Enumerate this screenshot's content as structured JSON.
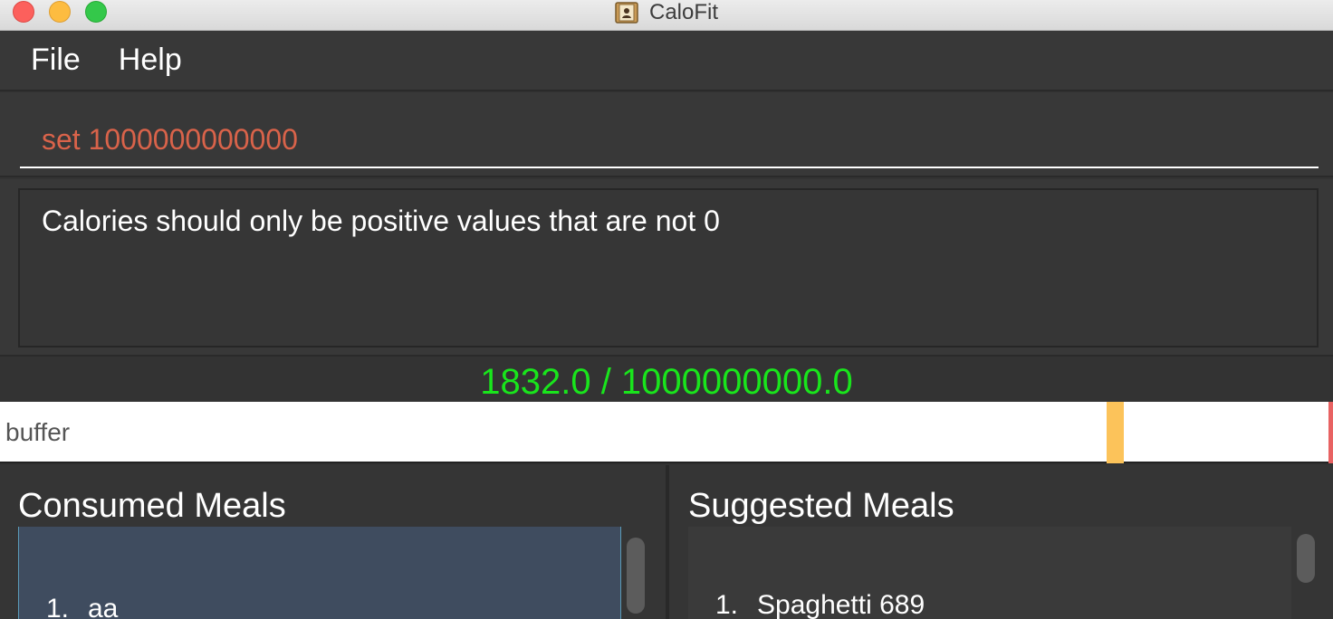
{
  "window": {
    "title": "CaloFit"
  },
  "menu": {
    "items": [
      {
        "label": "File"
      },
      {
        "label": "Help"
      }
    ]
  },
  "command": {
    "value": "set 1000000000000"
  },
  "result": {
    "message": "Calories should only be positive values that are not 0"
  },
  "status": {
    "calorie_text": "1832.0 / 1000000000.0"
  },
  "buffer": {
    "label": "buffer"
  },
  "consumed": {
    "title": "Consumed Meals",
    "items": [
      {
        "index": "1.",
        "name": "aa"
      }
    ]
  },
  "suggested": {
    "title": "Suggested Meals",
    "items": [
      {
        "index": "1.",
        "name": "Spaghetti 689"
      }
    ]
  },
  "colors": {
    "command_text": "#d9634a",
    "calorie_status": "#19e51c",
    "buffer_marker": "#fcc35a",
    "limit_marker": "#e86262",
    "selected_list_bg": "#3f4c5f"
  }
}
